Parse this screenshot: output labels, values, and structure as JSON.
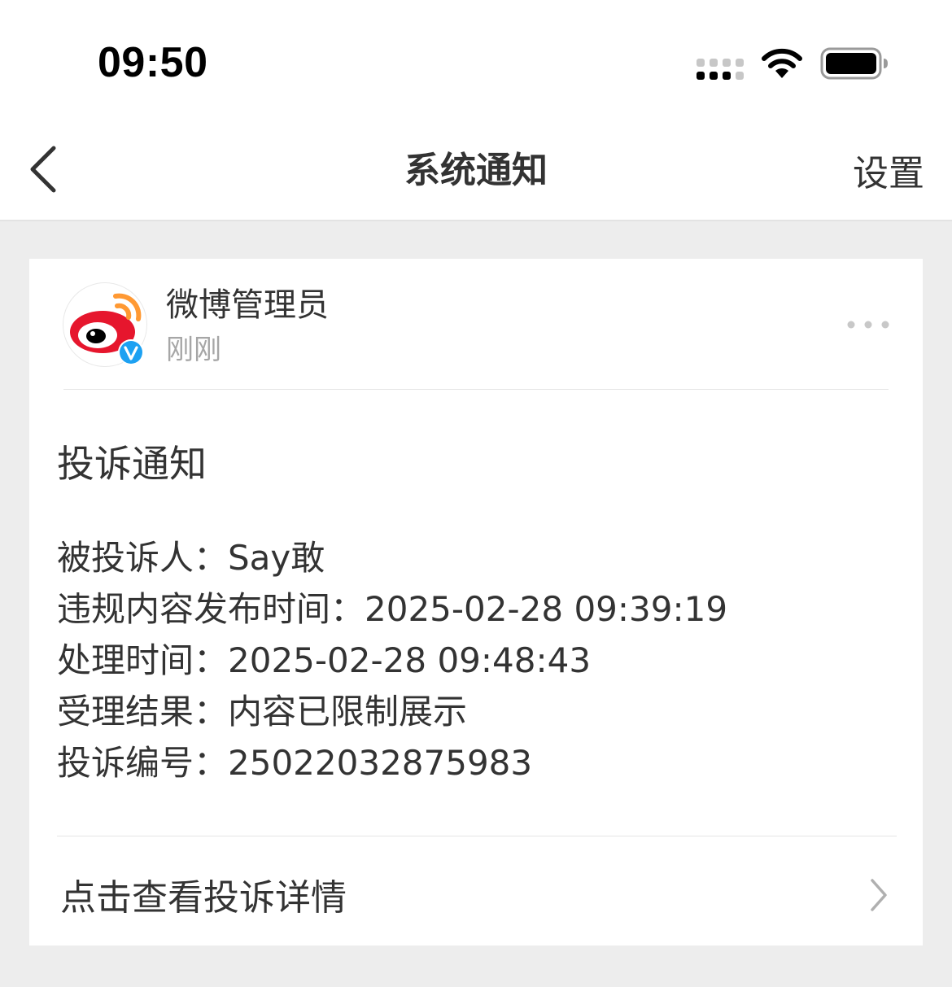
{
  "status_bar": {
    "time": "09:50",
    "icons": [
      "cellular-signal-icon",
      "wifi-icon",
      "battery-icon"
    ]
  },
  "nav": {
    "back_icon": "chevron-left-icon",
    "title": "系统通知",
    "settings_label": "设置"
  },
  "message": {
    "sender_name": "微博管理员",
    "sender_time": "刚刚",
    "avatar_icon": "weibo-logo-icon",
    "verified_icon": "verified-badge-icon",
    "more_icon": "more-icon",
    "title": "投诉通知",
    "details": [
      {
        "label": "被投诉人：",
        "value": "Say敢"
      },
      {
        "label": "违规内容发布时间：",
        "value": "2025-02-28 09:39:19"
      },
      {
        "label": "处理时间：",
        "value": "2025-02-28 09:48:43"
      },
      {
        "label": "受理结果：",
        "value": "内容已限制展示"
      },
      {
        "label": "投诉编号：",
        "value": "25022032875983"
      }
    ],
    "action_label": "点击查看投诉详情",
    "action_icon": "chevron-right-icon"
  },
  "colors": {
    "background": "#ededed",
    "card": "#ffffff",
    "text_primary": "#333333",
    "text_secondary": "#a6a6a6",
    "weibo_red": "#e6162d",
    "weibo_orange": "#ff9933",
    "verified_blue": "#1da1f2"
  }
}
